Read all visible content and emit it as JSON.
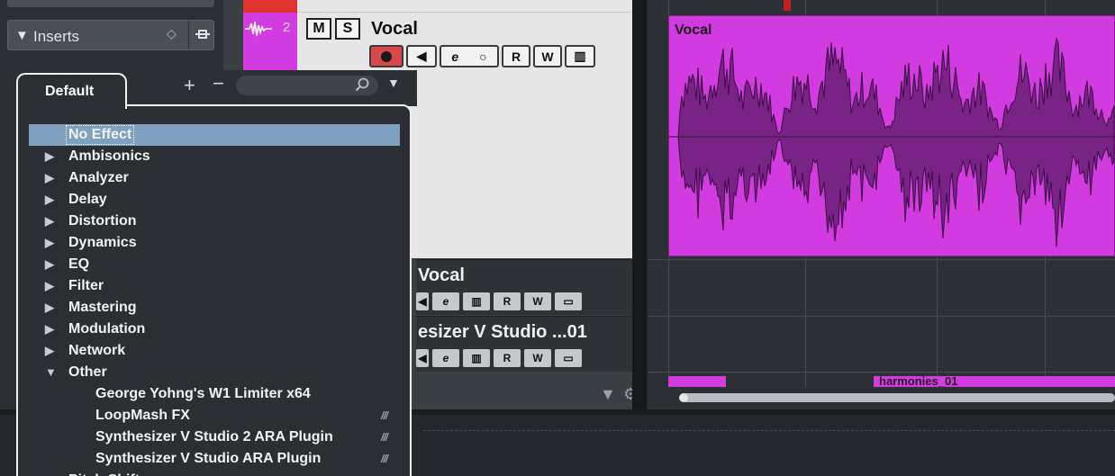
{
  "inserts": {
    "label": "Inserts"
  },
  "tracks": [
    {
      "number": "2",
      "name": "Vocal",
      "mute_label": "M",
      "solo_label": "S",
      "read_label": "R",
      "write_label": "W"
    },
    {
      "name": "Vocal",
      "read_label": "R",
      "write_label": "W"
    },
    {
      "name": "esizer V Studio ...01",
      "read_label": "R",
      "write_label": "W"
    }
  ],
  "arrange": {
    "event_name": "Vocal",
    "bottom_event_name": "harmonies_01"
  },
  "colors": {
    "track_color": "#d23be0",
    "record_active": "#d84848",
    "selection": "#7fa0bf"
  },
  "popup": {
    "tab_label": "Default",
    "add_label": "+",
    "remove_label": "−",
    "search_placeholder": "",
    "items": [
      {
        "label": "No Effect",
        "type": "item",
        "selected": true
      },
      {
        "label": "Ambisonics",
        "type": "folder"
      },
      {
        "label": "Analyzer",
        "type": "folder"
      },
      {
        "label": "Delay",
        "type": "folder"
      },
      {
        "label": "Distortion",
        "type": "folder"
      },
      {
        "label": "Dynamics",
        "type": "folder"
      },
      {
        "label": "EQ",
        "type": "folder"
      },
      {
        "label": "Filter",
        "type": "folder"
      },
      {
        "label": "Mastering",
        "type": "folder"
      },
      {
        "label": "Modulation",
        "type": "folder"
      },
      {
        "label": "Network",
        "type": "folder"
      },
      {
        "label": "Other",
        "type": "folder-open"
      },
      {
        "label": "George Yohng's W1 Limiter x64",
        "type": "plugin"
      },
      {
        "label": "LoopMash FX",
        "type": "plugin",
        "badge": "///"
      },
      {
        "label": "Synthesizer V Studio 2 ARA Plugin",
        "type": "plugin",
        "badge": "///"
      },
      {
        "label": "Synthesizer V Studio ARA Plugin",
        "type": "plugin",
        "badge": "///"
      },
      {
        "label": "Pitch Shift",
        "type": "folder"
      }
    ]
  }
}
